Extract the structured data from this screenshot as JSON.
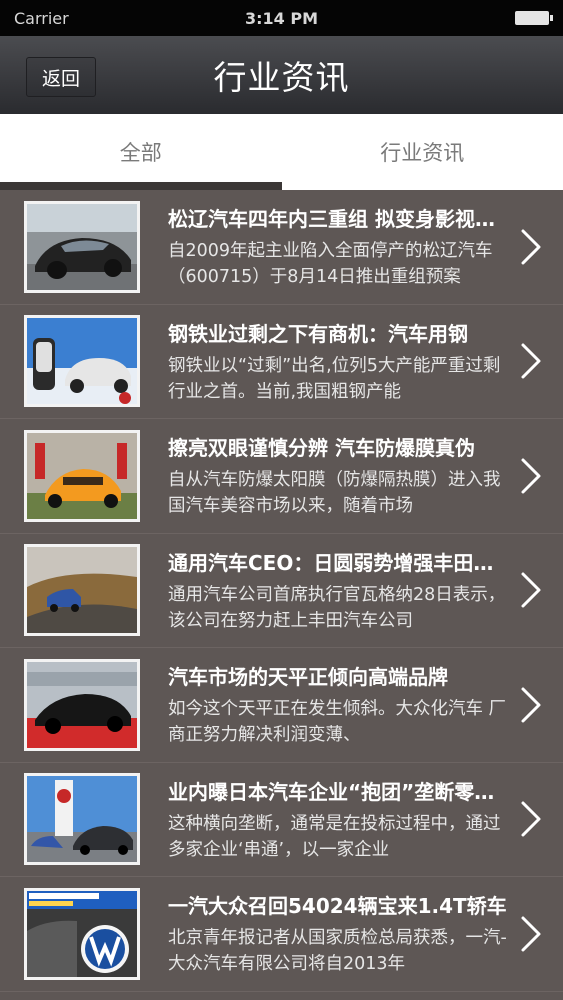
{
  "status_bar": {
    "carrier": "Carrier",
    "time": "3:14 PM"
  },
  "nav": {
    "back_label": "返回",
    "title": "行业资讯"
  },
  "tabs": [
    {
      "label": "全部",
      "active": true
    },
    {
      "label": "行业资讯",
      "active": false
    }
  ],
  "articles": [
    {
      "title": "松辽汽车四年内三重组 拟变身影视公司",
      "desc": " 自2009年起主业陷入全面停产的松辽汽车（600715）于8月14日推出重组预案",
      "thumb": "silver-sports-car"
    },
    {
      "title": "钢铁业过剩之下有商机：汽车用钢",
      "desc": "钢铁业以“过剩”出名,位列5大产能严重过剩行业之首。当前,我国粗钢产能",
      "thumb": "car-seat-and-suv"
    },
    {
      "title": "擦亮双眼谨慎分辨 汽车防爆膜真伪",
      "desc": "自从汽车防爆太阳膜（防爆隔热膜）进入我国汽车美容市场以来，随着市场",
      "thumb": "orange-supercar"
    },
    {
      "title": "通用汽车CEO：日圆弱势增强丰田竞争力",
      "desc": "通用汽车公司首席执行官瓦格纳28日表示，该公司在努力赶上丰田汽车公司",
      "thumb": "suv-on-road"
    },
    {
      "title": "汽车市场的天平正倾向高端品牌",
      "desc": "如今这个天平正在发生倾斜。大众化汽车 厂商正努力解决利润变薄、",
      "thumb": "black-supercar"
    },
    {
      "title": "业内曝日本汽车企业“抱团”垄断零部件",
      "desc": "这种横向垄断，通常是在投标过程中，通过多家企业‘串通’，以一家企业",
      "thumb": "dealership"
    },
    {
      "title": "一汽大众召回54024辆宝来1.4T轿车",
      "desc": "北京青年报记者从国家质检总局获悉，一汽-大众汽车有限公司将自2013年",
      "thumb": "vw-interior"
    }
  ],
  "colors": {
    "list_bg": "#5e5755",
    "nav_bg": "#3a3b3f",
    "tab_indicator": "#3b3736"
  }
}
